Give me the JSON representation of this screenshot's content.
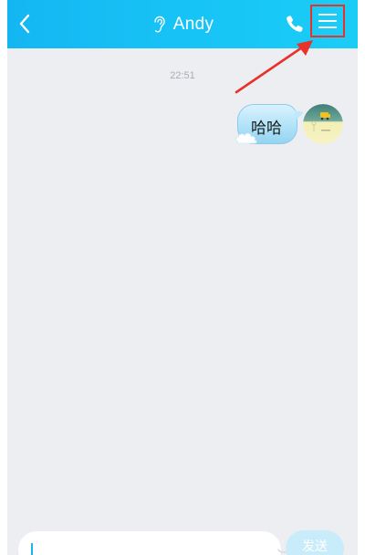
{
  "header": {
    "title": "Andy",
    "back_icon": "chevron-left-icon",
    "mode_icon": "ear-icon",
    "call_icon": "phone-icon",
    "menu_icon": "hamburger-menu-icon",
    "background": "#17c0f5"
  },
  "annotation": {
    "highlight_color": "#e8332a"
  },
  "chat": {
    "timestamp": "22:51",
    "messages": [
      {
        "text": "哈哈",
        "sender": "self"
      }
    ]
  },
  "composer": {
    "input_value": "",
    "send_label": "发送"
  }
}
